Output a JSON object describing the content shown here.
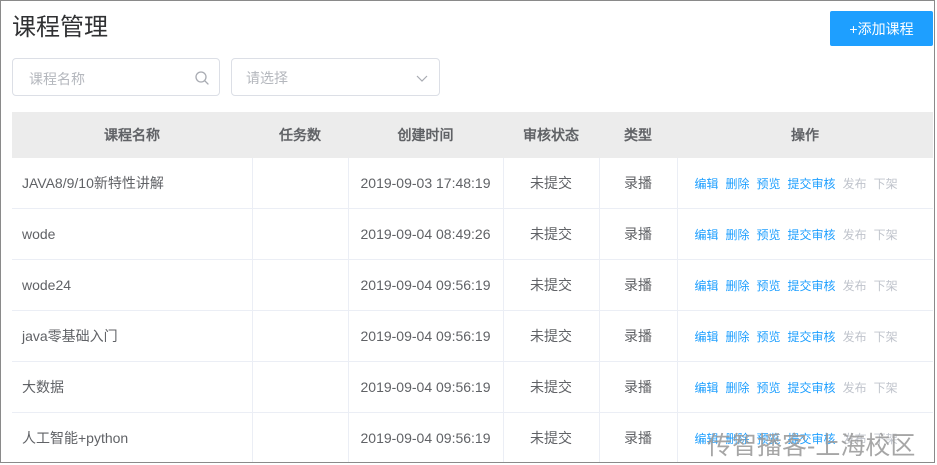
{
  "header": {
    "title": "课程管理",
    "add_label": "+添加课程"
  },
  "filters": {
    "search_placeholder": "课程名称",
    "select_placeholder": "请选择"
  },
  "table": {
    "columns": [
      "课程名称",
      "任务数",
      "创建时间",
      "审核状态",
      "类型",
      "操作"
    ],
    "rows": [
      {
        "name": "JAVA8/9/10新特性讲解",
        "tasks": "",
        "created": "2019-09-03 17:48:19",
        "status": "未提交",
        "type": "录播"
      },
      {
        "name": "wode",
        "tasks": "",
        "created": "2019-09-04 08:49:26",
        "status": "未提交",
        "type": "录播"
      },
      {
        "name": "wode24",
        "tasks": "",
        "created": "2019-09-04 09:56:19",
        "status": "未提交",
        "type": "录播"
      },
      {
        "name": "java零基础入门",
        "tasks": "",
        "created": "2019-09-04 09:56:19",
        "status": "未提交",
        "type": "录播"
      },
      {
        "name": "大数据",
        "tasks": "",
        "created": "2019-09-04 09:56:19",
        "status": "未提交",
        "type": "录播"
      },
      {
        "name": "人工智能+python",
        "tasks": "",
        "created": "2019-09-04 09:56:19",
        "status": "未提交",
        "type": "录播"
      }
    ],
    "actions": {
      "edit": "编辑",
      "delete": "删除",
      "preview": "预览",
      "submit": "提交审核",
      "publish": "发布",
      "offline": "下架"
    }
  },
  "colors": {
    "accent": "#1e9fff",
    "disabled": "#c0c4cc",
    "header_bg": "#ececec"
  },
  "watermark": "传智播客-上海校区"
}
